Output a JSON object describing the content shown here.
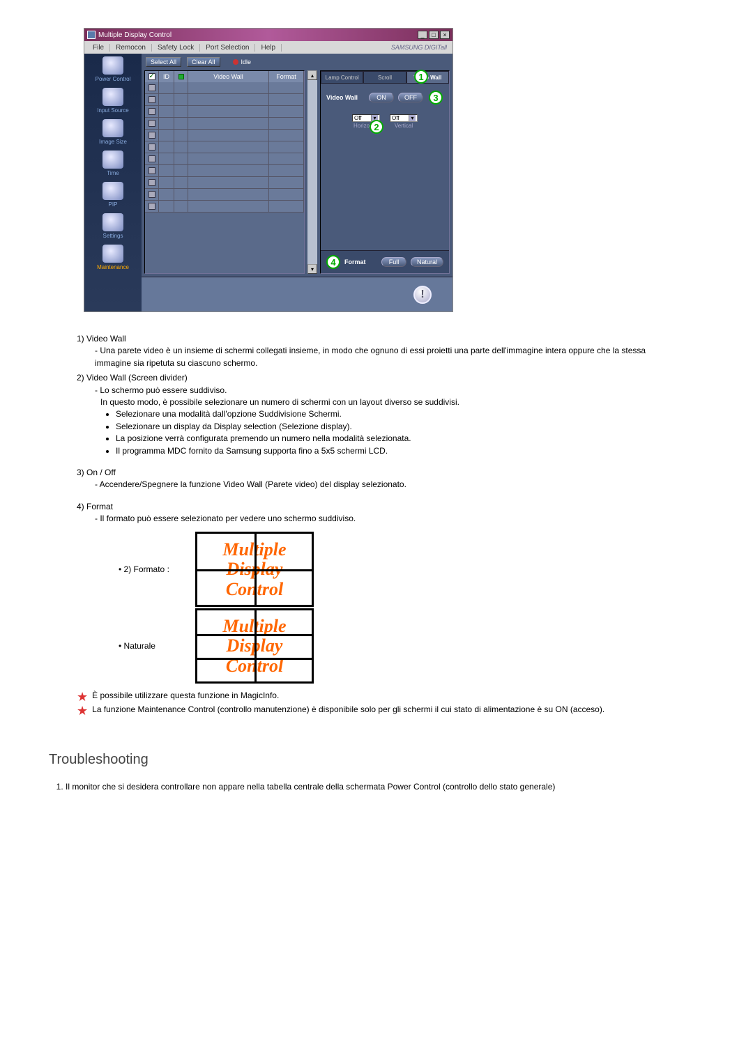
{
  "app": {
    "title": "Multiple Display Control",
    "menubar": [
      "File",
      "Remocon",
      "Safety Lock",
      "Port Selection",
      "Help"
    ],
    "brand": "SAMSUNG DIGITall"
  },
  "sidebar": {
    "items": [
      {
        "label": "Power Control"
      },
      {
        "label": "Input Source"
      },
      {
        "label": "Image Size"
      },
      {
        "label": "Time"
      },
      {
        "label": "PIP"
      },
      {
        "label": "Settings"
      },
      {
        "label": "Maintenance",
        "active": true
      }
    ]
  },
  "toolbar": {
    "select_all": "Select All",
    "clear_all": "Clear All",
    "idle": "Idle"
  },
  "grid": {
    "columns": {
      "chk": "",
      "id": "ID",
      "s": "",
      "video_wall": "Video Wall",
      "format": "Format"
    },
    "row_count": 11
  },
  "right": {
    "tabs": [
      "Lamp Control",
      "Scroll",
      "Video Wall"
    ],
    "active_tab": 2,
    "video_wall_label": "Video Wall",
    "on": "ON",
    "off": "OFF",
    "horizontal_label": "Horizontal",
    "vertical_label": "Vertical",
    "horizontal_value": "Off",
    "vertical_value": "Off",
    "format_label": "Format",
    "format_full": "Full",
    "format_natural": "Natural"
  },
  "callouts": {
    "c1": "1",
    "c2": "2",
    "c3": "3",
    "c4": "4"
  },
  "doc": {
    "i1_title": "1) Video Wall",
    "i1_b1": "- Una parete video è un insieme di schermi collegati insieme, in modo che ognuno di essi proietti una parte dell'immagine intera oppure che la stessa immagine sia ripetuta su ciascuno schermo.",
    "i2_title": "2) Video Wall (Screen divider)",
    "i2_b1": "- Lo schermo può essere suddiviso.",
    "i2_b2": "In questo modo, è possibile selezionare un numero di schermi con un layout diverso se suddivisi.",
    "i2_li1": "Selezionare una modalità dall'opzione Suddivisione Schermi.",
    "i2_li2": "Selezionare un display da Display selection (Selezione display).",
    "i2_li3": "La posizione verrà configurata premendo un numero nella modalità selezionata.",
    "i2_li4": "Il programma MDC fornito da Samsung supporta fino a 5x5 schermi LCD.",
    "i3_title": "3) On / Off",
    "i3_b1": "- Accendere/Spegnere la funzione Video Wall (Parete video) del display selezionato.",
    "i4_title": "4) Format",
    "i4_b1": "- Il formato può essere selezionato per vedere uno schermo suddiviso.",
    "fmt2_label": "2) Formato :",
    "fmt_nat_label": "Naturale",
    "mdc_line1": "Multiple",
    "mdc_line2": "Display",
    "mdc_line3": "Control",
    "star1": "È possibile utilizzare questa funzione in MagicInfo.",
    "star2": "La funzione Maintenance Control (controllo manutenzione) è disponibile solo per gli schermi il cui stato di alimentazione è su ON (acceso).",
    "ts_heading": "Troubleshooting",
    "ts_1": "Il monitor che si desidera controllare non appare nella tabella centrale della schermata Power Control (controllo dello stato generale)"
  }
}
